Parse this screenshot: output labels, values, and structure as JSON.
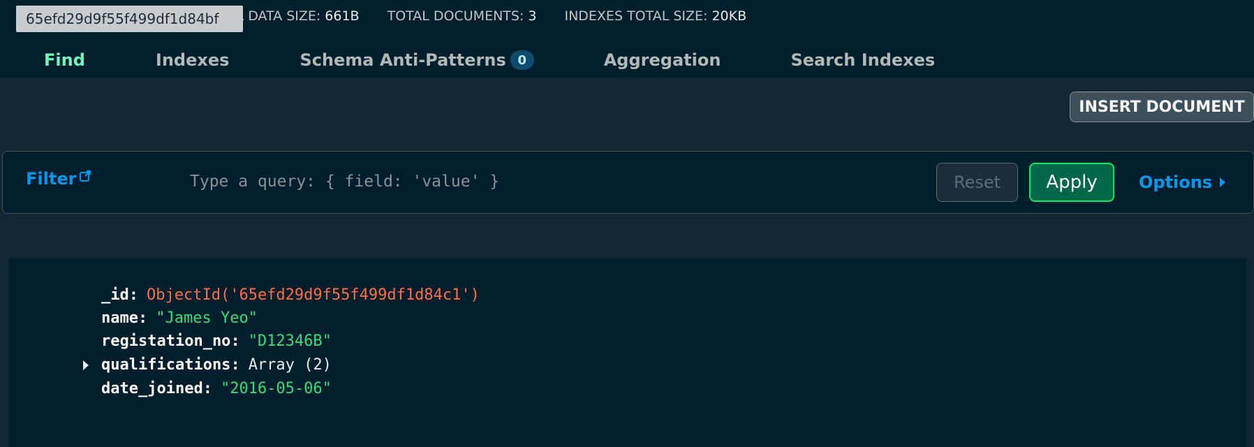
{
  "header": {
    "collection_id_tooltip": "65efd29d9f55f499df1d84bf",
    "stats": [
      {
        "label": "GICAL DATA SIZE:",
        "value": "661B"
      },
      {
        "label": "TOTAL DOCUMENTS:",
        "value": "3"
      },
      {
        "label": "INDEXES TOTAL SIZE:",
        "value": "20KB"
      }
    ]
  },
  "tabs": [
    {
      "label": "Find",
      "active": true
    },
    {
      "label": "Indexes"
    },
    {
      "label": "Schema Anti-Patterns",
      "badge": "0"
    },
    {
      "label": "Aggregation"
    },
    {
      "label": "Search Indexes"
    }
  ],
  "toolbar": {
    "insert_label": "INSERT DOCUMENT"
  },
  "filter": {
    "label": "Filter",
    "placeholder": "Type a query: { field: 'value' }",
    "reset_label": "Reset",
    "apply_label": "Apply",
    "options_label": "Options"
  },
  "document": {
    "fields": [
      {
        "key": "_id",
        "value": "ObjectId('65efd29d9f55f499df1d84c1')",
        "type": "objectid"
      },
      {
        "key": "name",
        "value": "\"James Yeo\"",
        "type": "string"
      },
      {
        "key": "registation_no",
        "value": "\"D12346B\"",
        "type": "string"
      },
      {
        "key": "qualifications",
        "value": "Array (2)",
        "type": "array",
        "expandable": true
      },
      {
        "key": "date_joined",
        "value": "\"2016-05-06\"",
        "type": "string"
      }
    ]
  },
  "colors": {
    "active_tab": "#71f6ba",
    "link_blue": "#0498ec",
    "objectid": "#ff6f44",
    "string": "#35de7b",
    "apply_border": "#00ed64"
  }
}
